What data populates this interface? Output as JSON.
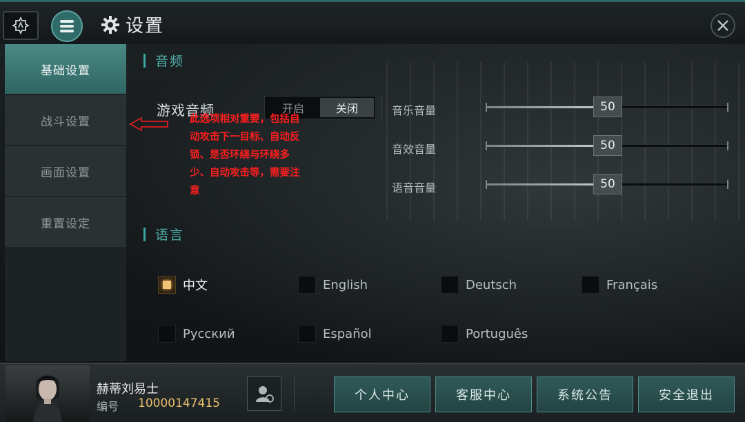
{
  "header": {
    "title": "设置",
    "map_icon": "map-icon",
    "menu_icon": "menu-icon",
    "settings_icon": "gear-icon",
    "close_icon": "close-icon"
  },
  "sidebar": {
    "items": [
      {
        "label": "基础设置",
        "active": true
      },
      {
        "label": "战斗设置",
        "active": false
      },
      {
        "label": "画面设置",
        "active": false
      },
      {
        "label": "重置设定",
        "active": false
      }
    ]
  },
  "audio": {
    "section_title": "音频",
    "game_audio_label": "游戏音频",
    "toggle": {
      "on": "开启",
      "off": "关闭",
      "selected": "off"
    },
    "sliders": [
      {
        "label": "音乐音量",
        "value": "50",
        "max": 100
      },
      {
        "label": "音效音量",
        "value": "50",
        "max": 100
      },
      {
        "label": "语音音量",
        "value": "50",
        "max": 100
      }
    ]
  },
  "annotation": {
    "text": "此选项相对重要，包括自动攻击下一目标、自动反锁、是否环绕与环绕多少、自动攻击等，需要注意",
    "color": "#ff1e1e"
  },
  "language": {
    "section_title": "语言",
    "options": [
      "中文",
      "English",
      "Deutsch",
      "Français",
      "Русский",
      "Español",
      "Português"
    ],
    "selected": "中文"
  },
  "player": {
    "name": "赫蒂刘易士",
    "id_label": "编号",
    "id": "10000147415",
    "switch_icon": "switch-account-icon"
  },
  "footer": {
    "buttons": [
      "个人中心",
      "客服中心",
      "系统公告",
      "安全退出"
    ]
  },
  "colors": {
    "accent": "#3aa7a0",
    "id_gold": "#e8c06a",
    "selected_check": "#f2c47a"
  }
}
